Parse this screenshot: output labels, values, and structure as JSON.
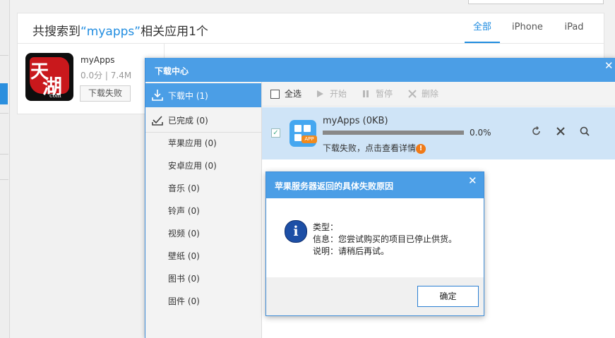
{
  "search_results": {
    "title_prefix": "共搜索到",
    "keyword": "“myapps”",
    "title_suffix": "相关应用1个",
    "tabs": [
      {
        "label": "全部",
        "active": true
      },
      {
        "label": "iPhone",
        "active": false
      },
      {
        "label": "iPad",
        "active": false
      }
    ],
    "app": {
      "icon_glyphs": [
        "天",
        "湖"
      ],
      "icon_caption": "com",
      "name": "myApps",
      "meta": "0.0分 | 7.4M",
      "button_label": "下载失败"
    }
  },
  "download_center": {
    "title": "下载中心",
    "close_glyph": "✕",
    "sidebar": {
      "downloading": {
        "label": "下载中 (1)",
        "selected": true
      },
      "completed": {
        "label": "已完成 (0)"
      },
      "categories": [
        "苹果应用 (0)",
        "安卓应用 (0)",
        "音乐 (0)",
        "铃声 (0)",
        "视频 (0)",
        "壁纸 (0)",
        "图书 (0)",
        "固件 (0)"
      ]
    },
    "toolbar": {
      "select_all": "全选",
      "start": "开始",
      "pause": "暂停",
      "delete": "删除"
    },
    "item": {
      "icon_badge": "APP",
      "name": "myApps (0KB)",
      "progress_percent": 0.0,
      "progress_text": "0.0%",
      "status_text": "下载失败，点击查看详情",
      "warn_glyph": "!",
      "checked": true
    }
  },
  "dialog": {
    "title": "苹果服务器返回的具体失败原因",
    "close_glyph": "✕",
    "icon_glyph": "i",
    "lines": [
      "类型：",
      "信息：您尝试购买的项目已停止供货。",
      "说明：请稍后再试。"
    ],
    "ok_label": "确定"
  },
  "colors": {
    "accent": "#1f8ce0",
    "header_blue": "#4b9ee6",
    "row_selected": "#cfe4f7",
    "warning": "#f07a17"
  }
}
